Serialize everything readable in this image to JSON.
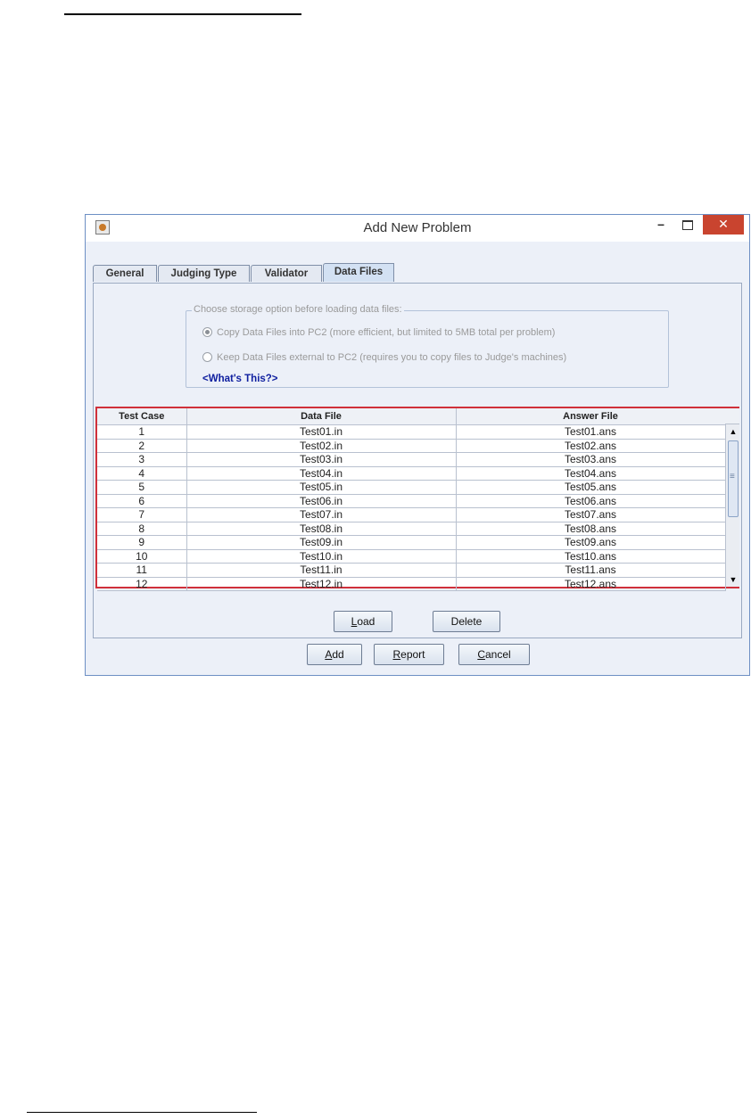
{
  "window": {
    "title": "Add New Problem",
    "minimize_glyph": "–",
    "close_glyph": "✕"
  },
  "tabs": [
    {
      "label": "General",
      "active": false
    },
    {
      "label": "Judging Type",
      "active": false
    },
    {
      "label": "Validator",
      "active": false
    },
    {
      "label": "Data Files",
      "active": true
    }
  ],
  "storage": {
    "title": "Choose storage option before loading data files:",
    "option1": "Copy Data Files into PC2 (more efficient, but limited to 5MB total per problem)",
    "option2": "Keep Data Files external to PC2 (requires you to copy files to Judge's machines)",
    "selected": "option1",
    "help_link": "<What's This?>"
  },
  "table": {
    "columns": [
      "Test Case",
      "Data File",
      "Answer File"
    ],
    "rows": [
      [
        "1",
        "Test01.in",
        "Test01.ans"
      ],
      [
        "2",
        "Test02.in",
        "Test02.ans"
      ],
      [
        "3",
        "Test03.in",
        "Test03.ans"
      ],
      [
        "4",
        "Test04.in",
        "Test04.ans"
      ],
      [
        "5",
        "Test05.in",
        "Test05.ans"
      ],
      [
        "6",
        "Test06.in",
        "Test06.ans"
      ],
      [
        "7",
        "Test07.in",
        "Test07.ans"
      ],
      [
        "8",
        "Test08.in",
        "Test08.ans"
      ],
      [
        "9",
        "Test09.in",
        "Test09.ans"
      ],
      [
        "10",
        "Test10.in",
        "Test10.ans"
      ],
      [
        "11",
        "Test11.in",
        "Test11.ans"
      ],
      [
        "12",
        "Test12.in",
        "Test12.ans"
      ]
    ],
    "scroll_up_glyph": "▲",
    "scroll_down_glyph": "▼"
  },
  "panel_buttons": {
    "load": {
      "mnemonic": "L",
      "rest": "oad"
    },
    "delete": {
      "label": "Delete"
    }
  },
  "dialog_buttons": {
    "add": {
      "mnemonic": "A",
      "rest": "dd"
    },
    "report": {
      "mnemonic": "R",
      "rest": "eport"
    },
    "cancel": {
      "mnemonic": "C",
      "rest": "ancel"
    }
  },
  "colors": {
    "table_highlight_border": "#d0303a",
    "link": "#1020a0",
    "close_button": "#c9442f"
  }
}
